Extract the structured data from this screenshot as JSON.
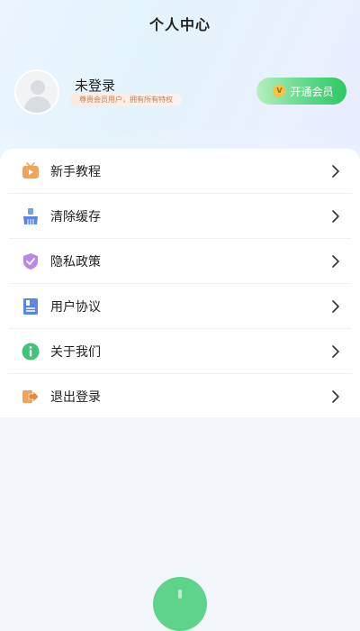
{
  "header": {
    "title": "个人中心"
  },
  "profile": {
    "name": "未登录",
    "tag": "尊贵会员用户，拥有所有特权",
    "vip_button": "开通会员",
    "vip_coin": "V"
  },
  "menu": {
    "items": [
      {
        "label": "新手教程",
        "icon": "tv-icon"
      },
      {
        "label": "清除缓存",
        "icon": "broom-icon"
      },
      {
        "label": "隐私政策",
        "icon": "shield-icon"
      },
      {
        "label": "用户协议",
        "icon": "document-icon"
      },
      {
        "label": "关于我们",
        "icon": "info-icon"
      },
      {
        "label": "退出登录",
        "icon": "logout-icon"
      }
    ]
  },
  "colors": {
    "accent_green": "#2ec765",
    "tag_text": "#c97d59"
  }
}
